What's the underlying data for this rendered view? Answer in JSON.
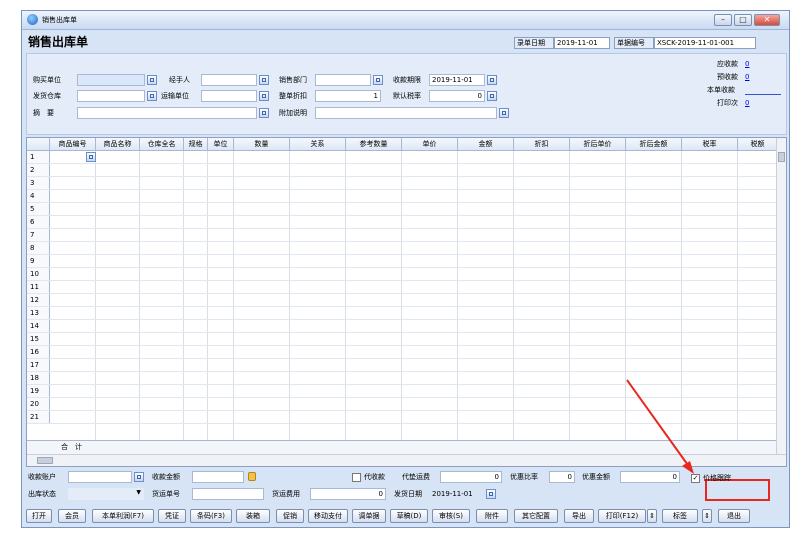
{
  "window": {
    "title": "销售出库单",
    "form_title": "销售出库单"
  },
  "header": {
    "bill_date_label": "录单日期",
    "bill_date": "2019-11-01",
    "bill_no_label": "单据编号",
    "bill_no": "XSCK-2019-11-01-001"
  },
  "form": {
    "buyer_label": "购买单位",
    "handler_label": "经手人",
    "dept_label": "销售部门",
    "collect_deadline_label": "收款期限",
    "collect_deadline": "2019-11-01",
    "warehouse_label": "发货仓库",
    "transport_label": "运输单位",
    "discount_label": "整单折扣",
    "discount": "1",
    "tax_label": "默认税率",
    "tax": "0",
    "summary_label": "摘　要",
    "note_label": "附加说明"
  },
  "summary": {
    "receivable_label": "应收款",
    "receivable": "0",
    "prepaid_label": "预收款",
    "prepaid": "0",
    "this_collect_label": "本单收款",
    "print_label": "打印次",
    "print": "0"
  },
  "grid": {
    "columns": [
      "商品编号",
      "商品名称",
      "仓库全名",
      "规格",
      "单位",
      "数量",
      "关系",
      "参考数量",
      "单价",
      "金额",
      "折扣",
      "折后单价",
      "折后金额",
      "税率",
      "税额"
    ],
    "rows": [
      "1",
      "2",
      "3",
      "4",
      "5",
      "6",
      "7",
      "8",
      "9",
      "10",
      "11",
      "12",
      "13",
      "14",
      "15",
      "16",
      "17",
      "18",
      "19",
      "20",
      "21"
    ],
    "total_label": "合　计"
  },
  "bottom": {
    "account_label": "收款账户",
    "collect_amount_label": "收款金额",
    "proxy_label": "代收款",
    "proxy_fee_label": "代垫运费",
    "proxy_fee": "0",
    "favor_rate_label": "优惠比率",
    "favor_rate": "0",
    "favor_amount_label": "优惠金额",
    "favor_amount": "0",
    "price_track_label": "价格跟踪",
    "ship_status_label": "出库状态",
    "freight_no_label": "货运单号",
    "freight_fee_label": "货运费用",
    "freight_fee": "0",
    "ship_date_label": "发货日期",
    "ship_date": "2019-11-01"
  },
  "buttons": [
    "打开",
    "会员",
    "本单利润(F7)",
    "凭证",
    "条码(F3)",
    "装箱",
    "促销",
    "移动支付",
    "调单据",
    "草稿(D)",
    "审核(S)",
    "附件",
    "其它配置",
    "导出",
    "打印(F12)",
    "标签",
    "退出"
  ],
  "colors": {
    "highlight": "#e8281e",
    "panel": "#d7e4f5"
  }
}
